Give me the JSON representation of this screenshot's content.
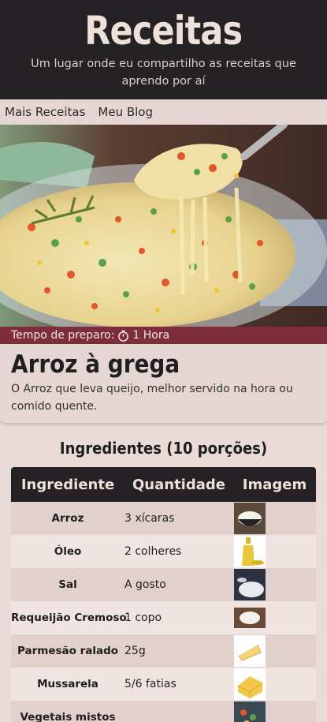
{
  "header": {
    "title": "Receitas",
    "subtitle": "Um lugar onde eu compartilho as receitas que aprendo por aí"
  },
  "nav": {
    "items": [
      "Mais Receitas",
      "Meu Blog"
    ]
  },
  "recipe": {
    "prep_label": "Tempo de preparo:",
    "prep_time": "1 Hora",
    "title": "Arroz à grega",
    "description": "O Arroz que leva queijo, melhor servido na hora ou comido quente."
  },
  "ingredients": {
    "heading": "Ingredientes (10 porções)",
    "columns": [
      "Ingrediente",
      "Quantidade",
      "Imagem"
    ],
    "rows": [
      {
        "name": "Arroz",
        "qty": "3 xícaras",
        "icon": "rice-bowl-icon"
      },
      {
        "name": "Óleo",
        "qty": "2 colheres",
        "icon": "oil-bottle-icon"
      },
      {
        "name": "Sal",
        "qty": "A gosto",
        "icon": "salt-icon"
      },
      {
        "name": "Requeijão Cremoso",
        "qty": "1 copo",
        "icon": "cream-cheese-icon"
      },
      {
        "name": "Parmesão ralado",
        "qty": "25g",
        "icon": "parmesan-icon"
      },
      {
        "name": "Mussarela",
        "qty": "5/6 fatias",
        "icon": "mozzarella-icon"
      },
      {
        "name": "Vegetais mistos",
        "qty": "",
        "icon": "vegetables-icon"
      }
    ]
  },
  "colors": {
    "header_bg": "#242225",
    "accent": "#7d2e3a",
    "page_bg": "#e9dcd8"
  }
}
